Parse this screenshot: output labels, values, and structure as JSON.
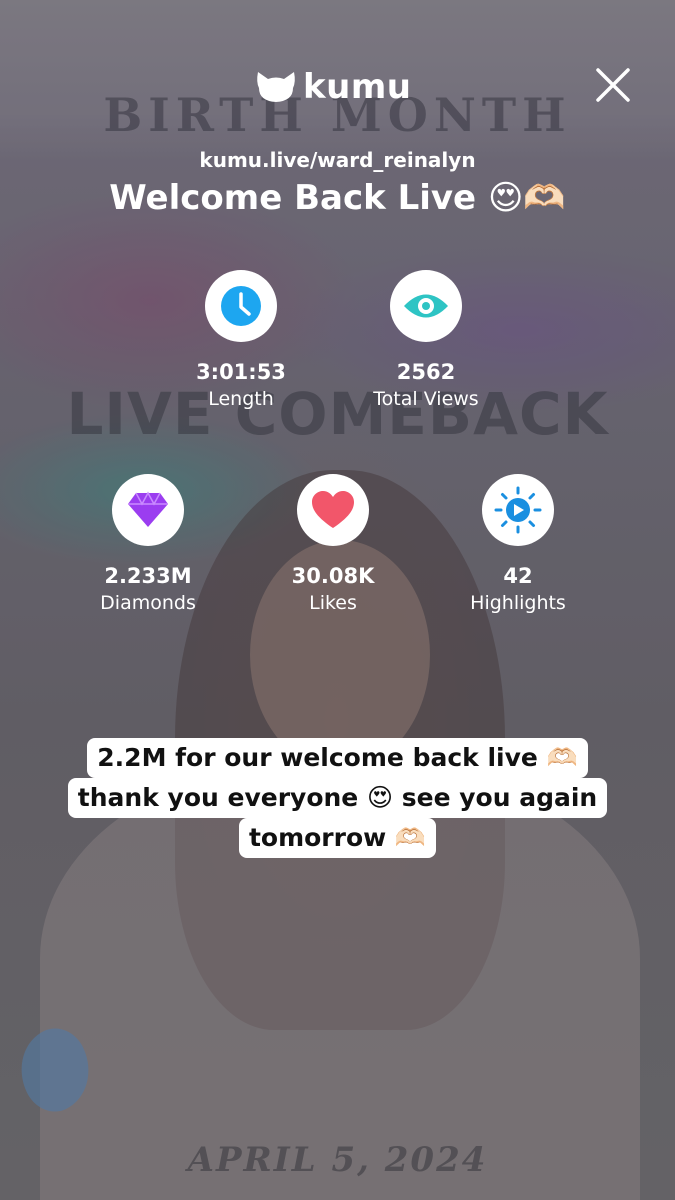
{
  "brand": {
    "name": "kumu"
  },
  "stream": {
    "url": "kumu.live/ward_reinalyn",
    "title": "Welcome Back Live 😍🫶🏻"
  },
  "stats": {
    "length": {
      "value": "3:01:53",
      "label": "Length"
    },
    "total_views": {
      "value": "2562",
      "label": "Total Views"
    },
    "diamonds": {
      "value": "2.233M",
      "label": "Diamonds"
    },
    "likes": {
      "value": "30.08K",
      "label": "Likes"
    },
    "highlights": {
      "value": "42",
      "label": "Highlights"
    }
  },
  "caption": {
    "lines": [
      "2.2M for our welcome back live 🫶🏻",
      "thank you everyone 😍 see you again",
      "tomorrow 🫶🏻"
    ]
  },
  "background": {
    "top_text": "BIRTH MONTH",
    "middle_text": "LIVE COMEBACK",
    "bottom_text": "APRIL 5, 2024"
  },
  "colors": {
    "clock": "#1da6f0",
    "eye": "#2ec4c4",
    "diamond": "#9b3df0",
    "heart": "#f2566a",
    "highlight": "#1a8fe0"
  },
  "icons": [
    "kumu-logo-icon",
    "close-icon",
    "clock-icon",
    "eye-icon",
    "diamond-icon",
    "heart-icon",
    "highlights-icon"
  ]
}
